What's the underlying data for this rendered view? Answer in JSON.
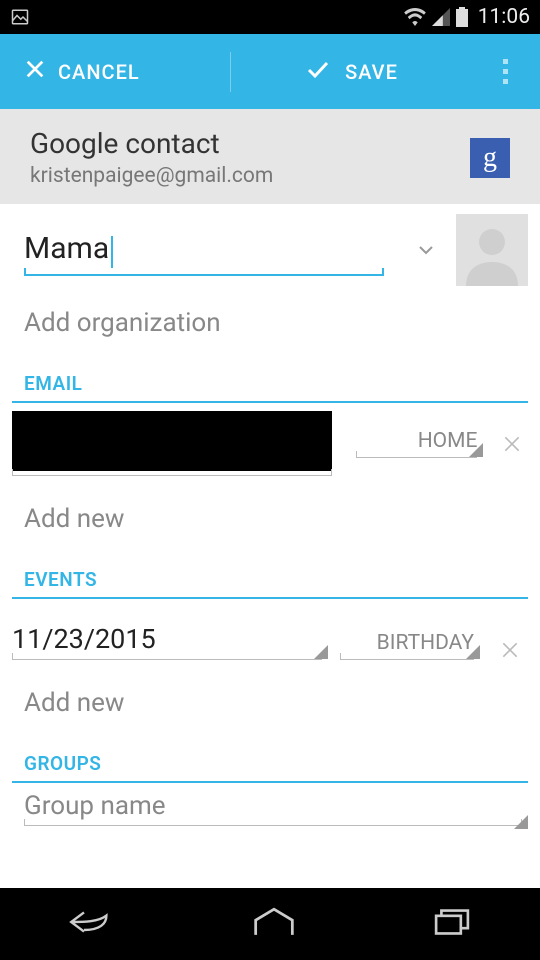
{
  "status": {
    "time": "11:06"
  },
  "actions": {
    "cancel": "CANCEL",
    "save": "SAVE"
  },
  "account": {
    "title": "Google contact",
    "email": "kristenpaigee@gmail.com"
  },
  "name": {
    "value": "Mama"
  },
  "organization": {
    "add_label": "Add organization"
  },
  "sections": {
    "email": {
      "label": "EMAIL",
      "entry": {
        "value": "",
        "type": "HOME"
      },
      "add_new": "Add new"
    },
    "events": {
      "label": "EVENTS",
      "entry": {
        "value": "11/23/2015",
        "type": "BIRTHDAY"
      },
      "add_new": "Add new"
    },
    "groups": {
      "label": "GROUPS",
      "placeholder": "Group name"
    }
  }
}
